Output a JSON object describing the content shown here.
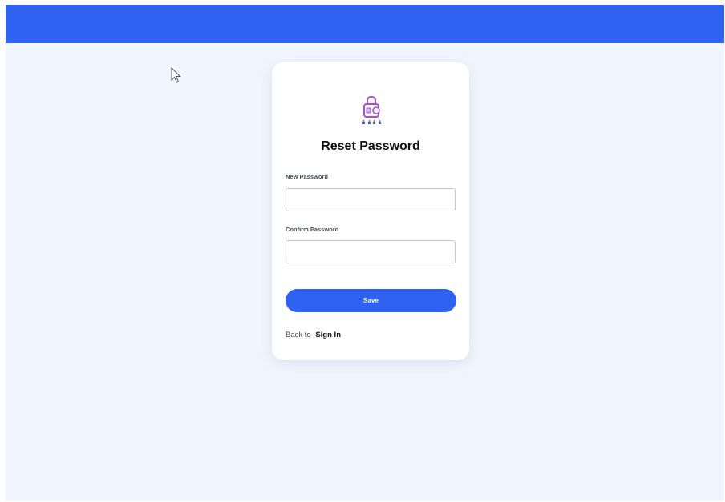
{
  "header": {
    "color": "#2f62f0"
  },
  "card": {
    "logo_icon": "lock-password-icon",
    "title": "Reset Password",
    "new_password": {
      "label": "New Password",
      "value": ""
    },
    "confirm_password": {
      "label": "Confirm Password",
      "value": ""
    },
    "save_label": "Save",
    "back_text": "Back to",
    "sign_in_label": "Sign In"
  },
  "colors": {
    "accent": "#2f62f0",
    "page_background": "#f1f5fd",
    "card_background": "#ffffff",
    "logo_purple": "#a64ad8"
  }
}
